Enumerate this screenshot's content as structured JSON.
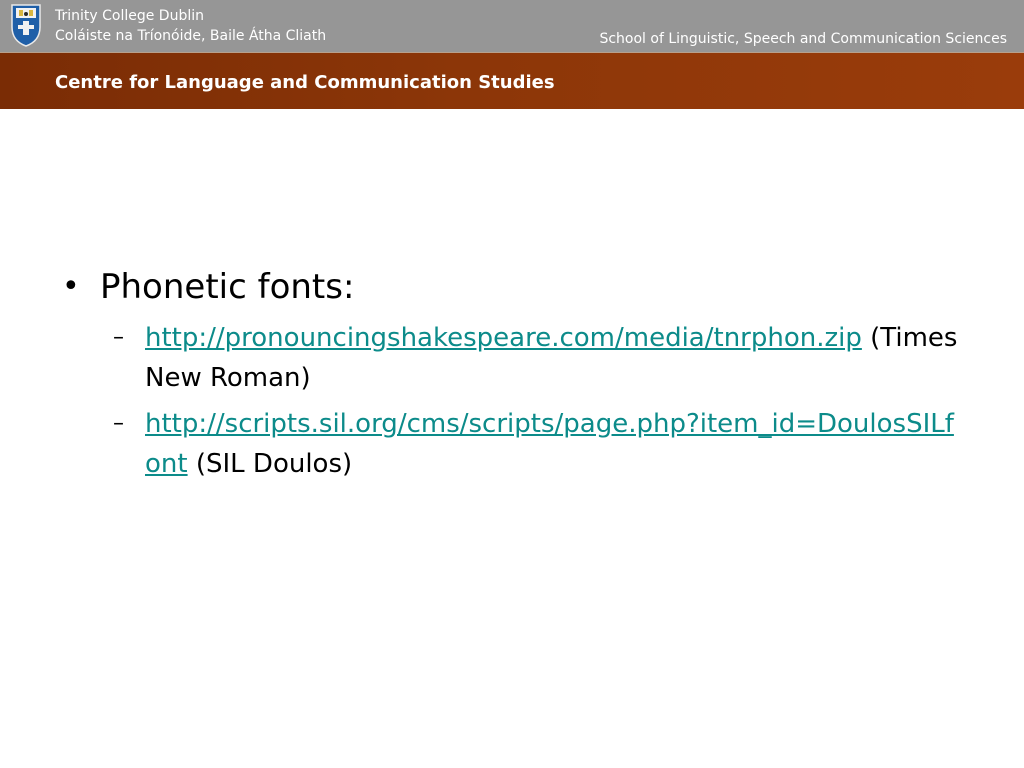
{
  "header": {
    "university_en": "Trinity College Dublin",
    "university_ga": "Coláiste na Tríonóide, Baile Átha Cliath",
    "school": "School of Linguistic, Speech and Communication Sciences",
    "centre": "Centre for Language and Communication Studies"
  },
  "content": {
    "bullet": "Phonetic fonts:",
    "items": [
      {
        "link": "http://pronouncingshakespeare.com/media/tnrphon.zip",
        "note": "(Times New Roman)"
      },
      {
        "link": "http://scripts.sil.org/cms/scripts/page.php?item_id=DoulosSILfont",
        "note": "(SIL Doulos)"
      }
    ]
  },
  "icons": {
    "crest": "college-crest-icon",
    "bullet": "bullet-icon",
    "dash": "dash-icon"
  },
  "colors": {
    "header_grey": "#969696",
    "band_brown": "#8c3608",
    "link_teal": "#0c8b8a"
  }
}
